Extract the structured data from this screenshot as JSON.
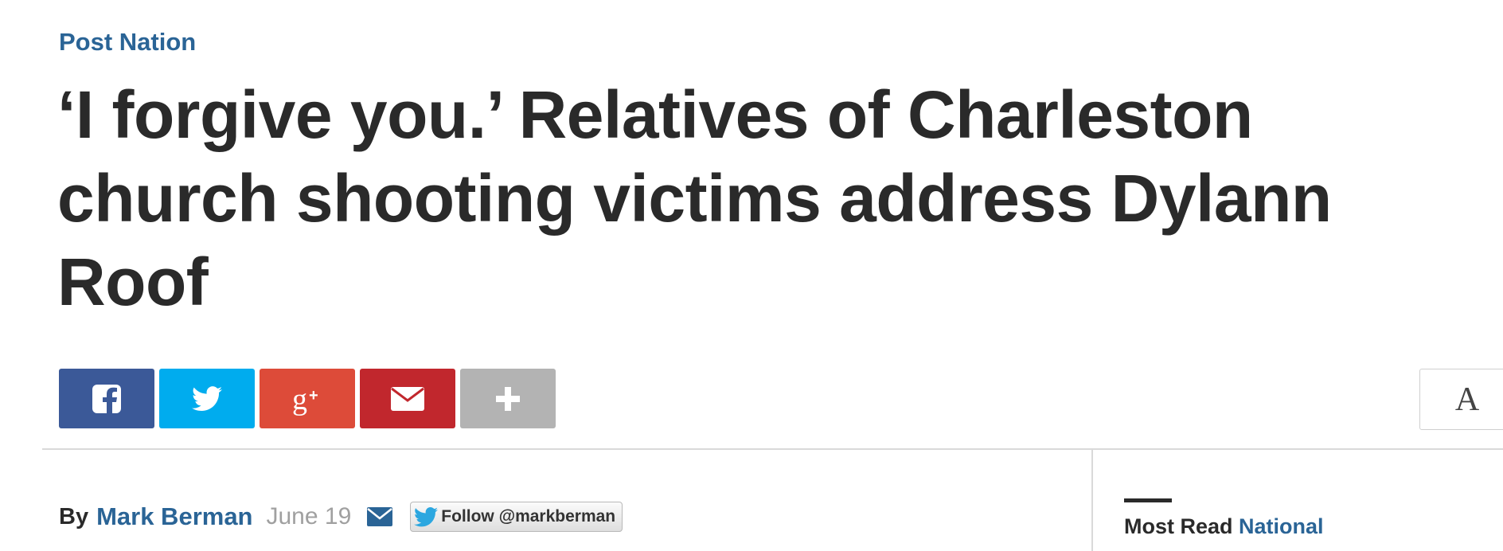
{
  "section": {
    "kicker": "Post Nation"
  },
  "article": {
    "headline": "‘I forgive you.’ Relatives of Charleston church shooting victims address Dylann Roof"
  },
  "share": {
    "buttons": [
      {
        "name": "facebook",
        "icon": "facebook-icon",
        "color": "#3b5998"
      },
      {
        "name": "twitter",
        "icon": "twitter-icon",
        "color": "#00acee"
      },
      {
        "name": "google-plus",
        "icon": "google-plus-icon",
        "color": "#dd4b39"
      },
      {
        "name": "email",
        "icon": "envelope-icon",
        "color": "#c1272d"
      },
      {
        "name": "more",
        "icon": "plus-icon",
        "color": "#b3b3b3"
      }
    ],
    "resize_label": "A"
  },
  "byline": {
    "by": "By",
    "author": "Mark Berman",
    "date": "June 19",
    "follow_label": "Follow @markberman"
  },
  "sidebar": {
    "heading_label": "Most Read",
    "heading_link": "National"
  },
  "colors": {
    "link": "#2a6496",
    "text": "#2a2a2a",
    "date": "#a0a0a0"
  }
}
